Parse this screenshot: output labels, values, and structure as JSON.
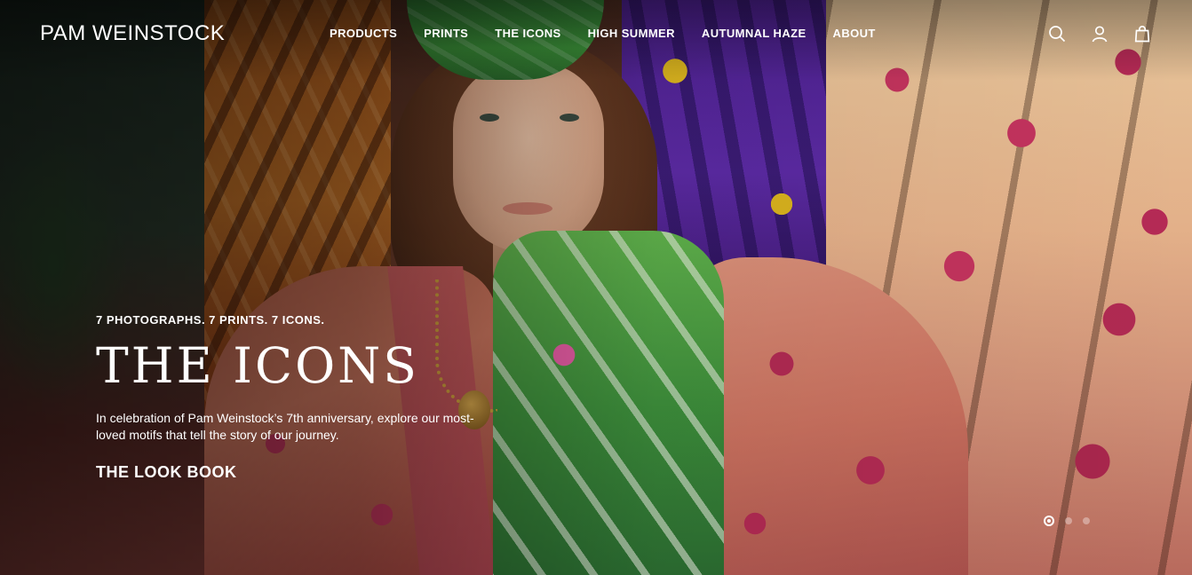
{
  "brand": {
    "logo_text": "PAM WEINSTOCK"
  },
  "nav": {
    "items": [
      {
        "label": "PRODUCTS"
      },
      {
        "label": "PRINTS"
      },
      {
        "label": "THE ICONS"
      },
      {
        "label": "HIGH SUMMER"
      },
      {
        "label": "AUTUMNAL HAZE"
      },
      {
        "label": "ABOUT"
      }
    ]
  },
  "utility_icons": [
    "search-icon",
    "account-icon",
    "bag-icon"
  ],
  "hero": {
    "eyebrow": "7 PHOTOGRAPHS. 7 PRINTS. 7 ICONS.",
    "headline": "THE ICONS",
    "description": "In celebration of Pam Weinstock’s 7th anniversary, explore our most-loved motifs that tell the story of our journey.",
    "cta_label": "THE LOOK BOOK"
  },
  "slider": {
    "total": 3,
    "active": 1
  },
  "colors": {
    "text": "#ffffff",
    "dot_inactive": "rgba(255,255,255,0.35)"
  }
}
